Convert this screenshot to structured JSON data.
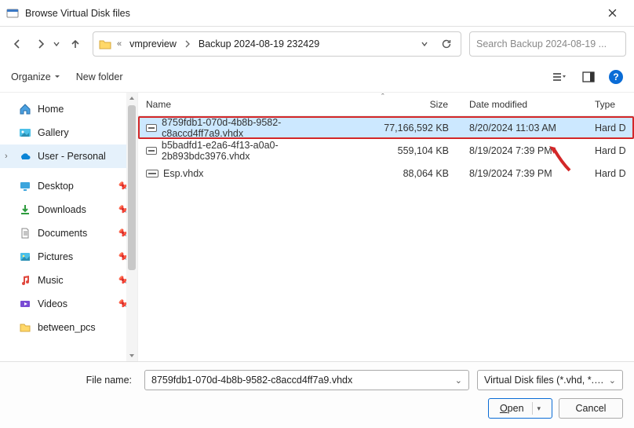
{
  "window": {
    "title": "Browse Virtual Disk files"
  },
  "breadcrumb": {
    "items": [
      "vmpreview",
      "Backup 2024-08-19 232429"
    ]
  },
  "search": {
    "placeholder": "Search Backup 2024-08-19 ..."
  },
  "toolbar": {
    "organize": "Organize",
    "newfolder": "New folder"
  },
  "sidebar": {
    "items": [
      {
        "label": "Home",
        "icon": "home"
      },
      {
        "label": "Gallery",
        "icon": "gallery"
      },
      {
        "label": "User - Personal",
        "icon": "onedrive",
        "active": true,
        "expandable": true
      },
      {
        "label": "",
        "icon": "sep"
      },
      {
        "label": "Desktop",
        "icon": "desktop",
        "pinned": true
      },
      {
        "label": "Downloads",
        "icon": "downloads",
        "pinned": true
      },
      {
        "label": "Documents",
        "icon": "documents",
        "pinned": true
      },
      {
        "label": "Pictures",
        "icon": "pictures",
        "pinned": true
      },
      {
        "label": "Music",
        "icon": "music",
        "pinned": true
      },
      {
        "label": "Videos",
        "icon": "videos",
        "pinned": true
      },
      {
        "label": "between_pcs",
        "icon": "folder",
        "pinned": false
      }
    ]
  },
  "columns": {
    "name": "Name",
    "size": "Size",
    "date": "Date modified",
    "type": "Type"
  },
  "files": [
    {
      "name": "8759fdb1-070d-4b8b-9582-c8accd4ff7a9.vhdx",
      "size": "77,166,592 KB",
      "date": "8/20/2024 11:03 AM",
      "type": "Hard D",
      "selected": true
    },
    {
      "name": "b5badfd1-e2a6-4f13-a0a0-2b893bdc3976.vhdx",
      "size": "559,104 KB",
      "date": "8/19/2024 7:39 PM",
      "type": "Hard D",
      "selected": false
    },
    {
      "name": "Esp.vhdx",
      "size": "88,064 KB",
      "date": "8/19/2024 7:39 PM",
      "type": "Hard D",
      "selected": false
    }
  ],
  "footer": {
    "filename_label": "File name:",
    "filename_value": "8759fdb1-070d-4b8b-9582-c8accd4ff7a9.vhdx",
    "filter": "Virtual Disk files (*.vhd, *.vhdx)",
    "open": "Open",
    "cancel": "Cancel"
  }
}
